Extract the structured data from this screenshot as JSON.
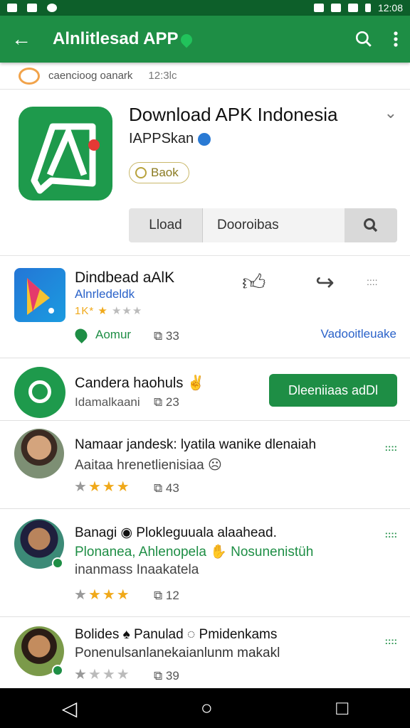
{
  "status_bar": {
    "time": "12:08",
    "left_icons": [
      "photo-icon",
      "warning-icon",
      "whatsapp-icon"
    ],
    "right_icons": [
      "mute-icon",
      "wifi-icon",
      "signal-icon",
      "battery-icon"
    ]
  },
  "app_bar": {
    "title": "Alnlitlesad APP",
    "back_icon": "arrow-left-icon",
    "actions": [
      "search-icon",
      "more-vert-icon"
    ]
  },
  "recent": {
    "text": "caencioog oanark",
    "time": "12:3lc"
  },
  "app": {
    "title": "Download APK Indonesia",
    "developer": "IAPPSkan",
    "badge": "Baok",
    "tabs": {
      "load": "Lload",
      "description": "Dooroibas"
    }
  },
  "cards": [
    {
      "title": "Dindbead aAlK",
      "subtitle": "Alnrledeldk",
      "stars_label": "1K*",
      "location": "Aomur",
      "count": "33",
      "link": "Vadooitleuake",
      "more": "::::"
    },
    {
      "title": "Candera haohuls",
      "subtitle": "Idamalkaani",
      "count": "23",
      "action": "Dleeniiaas adDl"
    }
  ],
  "reviews": [
    {
      "line1": "Namaar jandesk: lyatila wanike dlenaiah",
      "line2": "Aaitaa hrenetlienisiaa",
      "stars": 3,
      "count": "43",
      "tag": "::::"
    },
    {
      "line1": "Banagi ◉ Plokleguuala alaahead.",
      "line2": "Plonanea, Ahlenopela ✋ Nosunenistüh",
      "line3": "inanmass Inaakatela",
      "stars": 3,
      "count": "12",
      "tag": "::::"
    },
    {
      "line1": "Bolides ♠ Panulad ◌ Pmidenkams",
      "line2": "Ponenulsanlanekaianlunm makakl",
      "stars": 1,
      "count": "39",
      "tag": "::::"
    }
  ],
  "nav": {
    "back": "◁",
    "home": "○",
    "recents": "□"
  },
  "colors": {
    "primary": "#1e8e45",
    "status_bar": "#0d5f2a",
    "link": "#2a62c9",
    "star": "#f0a91a"
  }
}
